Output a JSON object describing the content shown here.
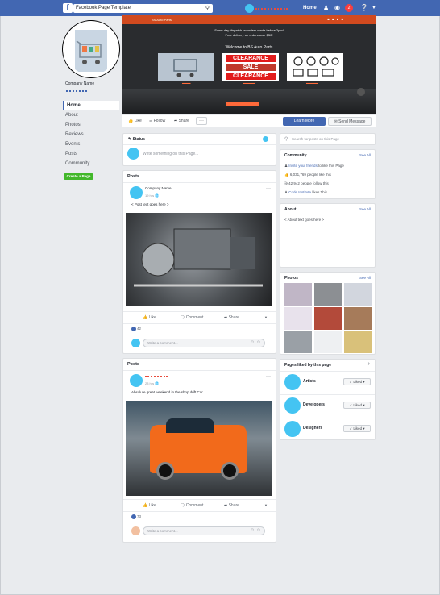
{
  "topbar": {
    "page_title": "Facebook Page Template",
    "home_label": "Home",
    "notification_count": "2",
    "colors": {
      "bar": "#4267b2",
      "accent": "#44c4f2",
      "badge": "#fa3e3e"
    }
  },
  "sidebar": {
    "company_name": "Company Name",
    "nav": [
      "Home",
      "About",
      "Photos",
      "Reviews",
      "Events",
      "Posts",
      "Community"
    ],
    "create_page": "Create a Page"
  },
  "cover": {
    "brand": "BS Auto Parts",
    "line1": "Same day dispatch on orders made before 2pm!",
    "line2": "Free delivery on orders over $50!",
    "welcome": "Welcome to BS Auto Parts",
    "clearance": [
      "CLEARANCE",
      "SALE",
      "CLEARANCE"
    ]
  },
  "actions": {
    "like": "Like",
    "follow": "Follow",
    "share": "Share",
    "more": "···",
    "learn_more": "Learn More",
    "send_message": "Send Message"
  },
  "status": {
    "label": "Status",
    "placeholder": "Write something on this Page..."
  },
  "posts": [
    {
      "section_title": "Posts",
      "author": "Company Name",
      "time": "19 hrs",
      "text": "< Post text goes here >",
      "likes": "42",
      "comment_placeholder": "Write a comment..."
    },
    {
      "section_title": "Posts",
      "author": "",
      "time": "23 hrs",
      "text": "Absolute great weekend in the shop drift Car",
      "likes": "73",
      "comment_placeholder": "Write a comment..."
    }
  ],
  "reactions": {
    "like": "Like",
    "comment": "Comment",
    "share": "Share"
  },
  "right": {
    "search_placeholder": "Search for posts on this Page",
    "community": {
      "title": "Community",
      "see_all": "See All",
      "invite_link": "Invite your friends",
      "invite_rest": "to like this Page",
      "likes": "6,031,769 people like this",
      "follows": "42,942 people follow this",
      "friend": "Code Institute",
      "friend_rest": "likes This"
    },
    "about": {
      "title": "About",
      "see_all": "See All",
      "text": "< About text goes here >"
    },
    "photos": {
      "title": "Photos",
      "see_all": "See All"
    },
    "pages_liked": {
      "title": "Pages liked by this page",
      "items": [
        {
          "name": "Artists",
          "button": "Liked"
        },
        {
          "name": "Developers",
          "button": "Liked"
        },
        {
          "name": "Designers",
          "button": "Liked"
        }
      ]
    }
  }
}
